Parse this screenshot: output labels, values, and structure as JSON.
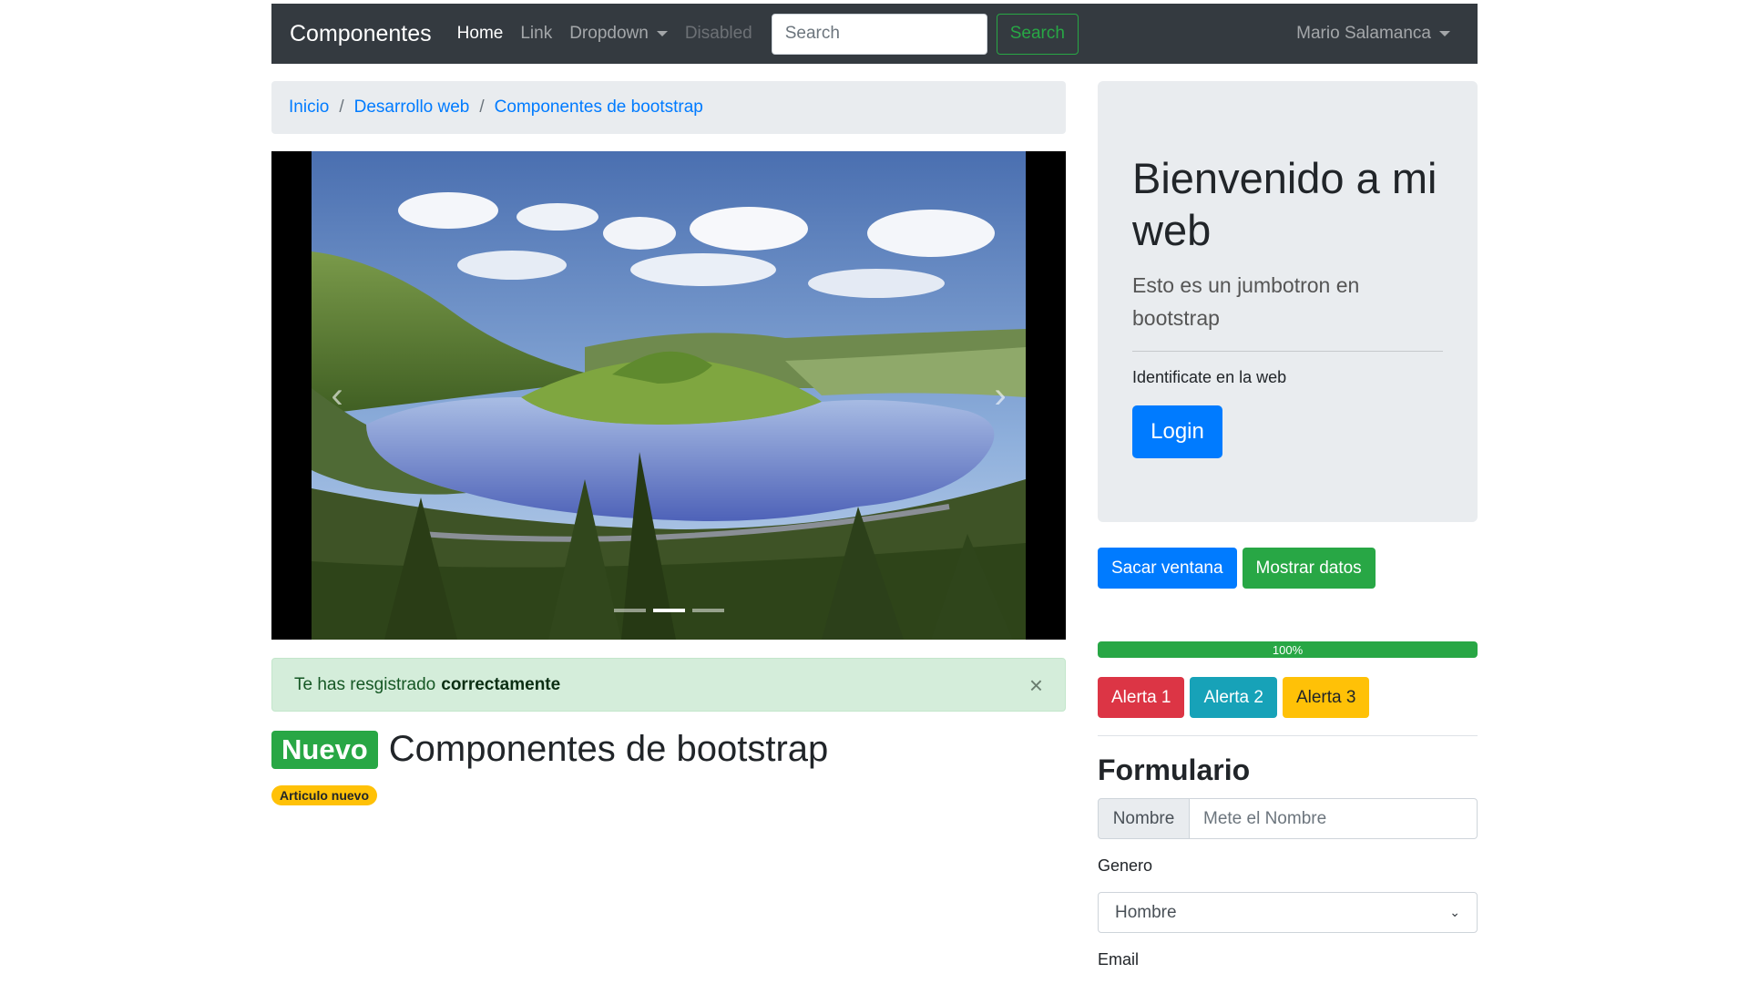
{
  "navbar": {
    "brand": "Componentes",
    "links": [
      "Home",
      "Link",
      "Dropdown",
      "Disabled"
    ],
    "search_placeholder": "Search",
    "search_button": "Search",
    "user": "Mario Salamanca"
  },
  "breadcrumb": [
    "Inicio",
    "Desarrollo web",
    "Componentes de bootstrap"
  ],
  "carousel": {
    "prev_icon": "chevron-left-icon",
    "next_icon": "chevron-right-icon",
    "indicators": 3,
    "active_index": 1
  },
  "alert": {
    "text": "Te has resgistrado",
    "strong": "correctamente",
    "close": "×"
  },
  "heading": {
    "badge": "Nuevo",
    "title": "Componentes de bootstrap",
    "pill": "Articulo nuevo"
  },
  "jumbotron": {
    "title": "Bienvenido a mi web",
    "lead": "Esto es un jumbotron en bootstrap",
    "text": "Identificate en la web",
    "button": "Login"
  },
  "buttons": [
    "Sacar ventana",
    "Mostrar datos"
  ],
  "progress": {
    "value": 1.0,
    "label": "100%"
  },
  "alert_buttons": [
    "Alerta 1",
    "Alerta 2",
    "Alerta 3"
  ],
  "form": {
    "title": "Formulario",
    "name_addon": "Nombre",
    "name_placeholder": "Mete el Nombre",
    "genero_label": "Genero",
    "genero_value": "Hombre",
    "email_label": "Email"
  },
  "colors": {
    "primary": "#007bff",
    "success": "#28a745",
    "danger": "#dc3545",
    "info": "#17a2b8",
    "warning": "#ffc107",
    "dark": "#343a40"
  }
}
